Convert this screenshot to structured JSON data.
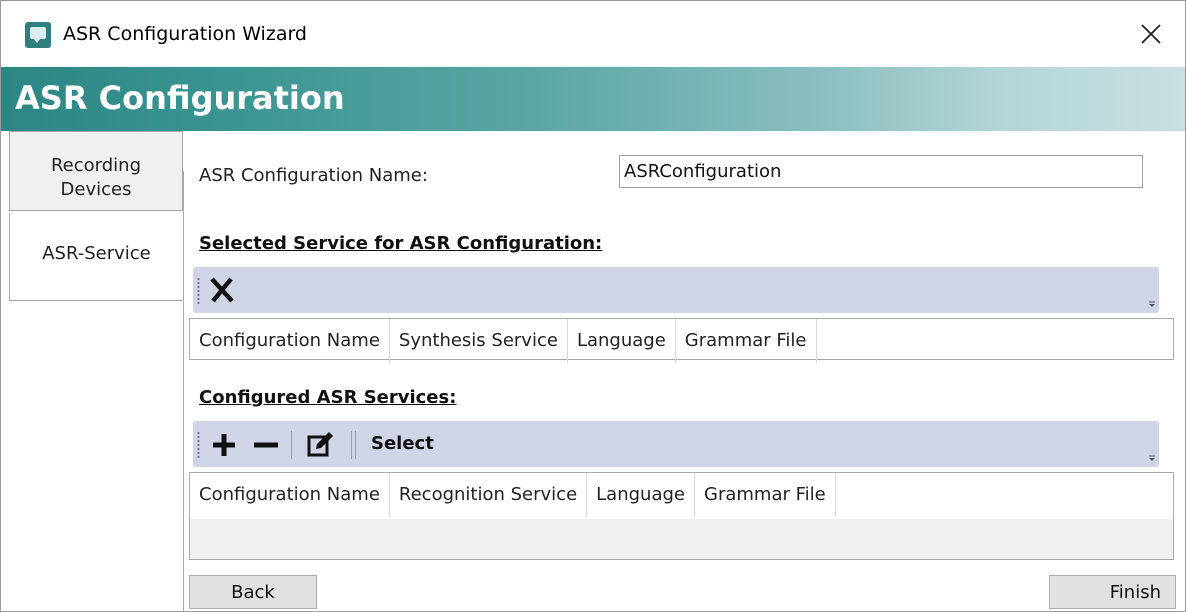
{
  "window": {
    "title": "ASR Configuration Wizard",
    "close_icon": "close-icon",
    "app_icon": "speech-bubble-icon"
  },
  "banner": {
    "title": "ASR Configuration",
    "gradient_start": "#2c8683",
    "gradient_end": "#c7e0e1"
  },
  "tabs": [
    {
      "label_line1": "Recording",
      "label_line2": "Devices",
      "selected": false
    },
    {
      "label": "ASR-Service",
      "selected": true
    }
  ],
  "config_name": {
    "label": "ASR Configuration Name:",
    "value": "ASRConfiguration"
  },
  "selected_section": {
    "title": "Selected Service for ASR Configuration:",
    "toolbar": {
      "remove_icon": "remove-x-icon"
    },
    "columns": [
      "Configuration Name",
      "Synthesis Service",
      "Language",
      "Grammar File"
    ],
    "rows": []
  },
  "configured_section": {
    "title": "Configured ASR Services:",
    "toolbar": {
      "add_icon": "plus-icon",
      "delete_icon": "minus-icon",
      "edit_icon": "edit-icon",
      "select_label": "Select"
    },
    "columns": [
      "Configuration Name",
      "Recognition Service",
      "Language",
      "Grammar File"
    ],
    "rows": []
  },
  "footer": {
    "back_label": "Back",
    "finish_label": "Finish"
  },
  "colors": {
    "toolbar_bg": "#cfd4e6",
    "button_bg": "#e1e1e1"
  }
}
